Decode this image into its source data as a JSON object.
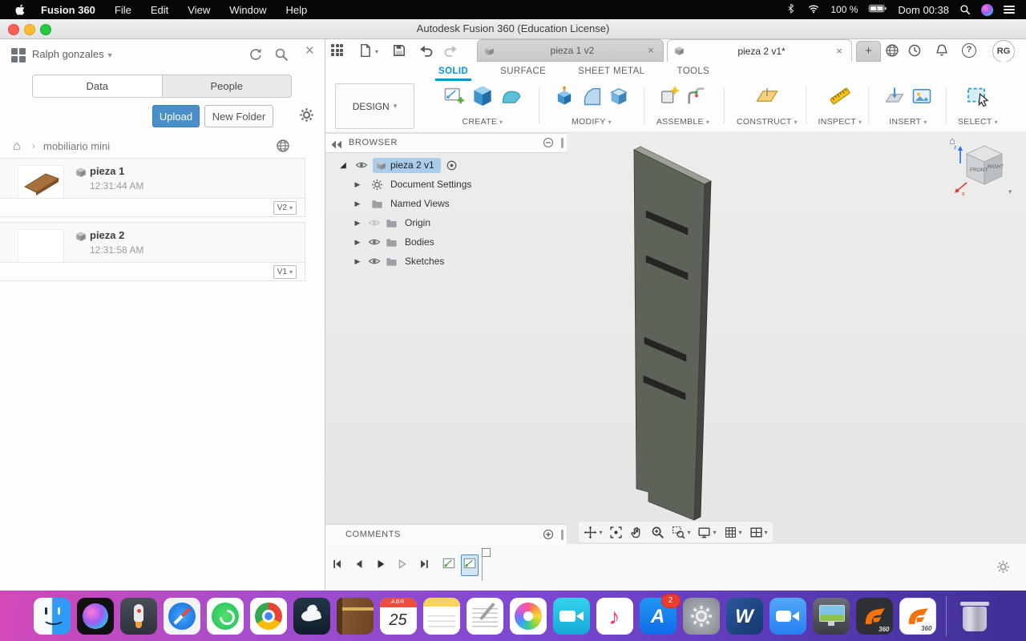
{
  "menubar": {
    "app_name": "Fusion 360",
    "items": [
      "File",
      "Edit",
      "View",
      "Window",
      "Help"
    ],
    "battery_label": "100 %",
    "clock_label": "Dom 00:38"
  },
  "titlebar": {
    "title": "Autodesk Fusion 360 (Education License)"
  },
  "data_panel": {
    "user_name": "Ralph gonzales",
    "tabs": [
      {
        "label": "Data"
      },
      {
        "label": "People"
      }
    ],
    "upload_label": "Upload",
    "new_folder_label": "New Folder",
    "breadcrumb_root": "mobiliario mini",
    "items": [
      {
        "name": "pieza 1",
        "time": "12:31:44 AM",
        "version": "V2"
      },
      {
        "name": "pieza 2",
        "time": "12:31:58 AM",
        "version": "V1"
      }
    ]
  },
  "workspace": {
    "doc_tabs": [
      {
        "label": "pieza 1 v2"
      },
      {
        "label": "pieza 2 v1*"
      }
    ],
    "avatar_initials": "RG",
    "ribbon_tabs": [
      {
        "label": "SOLID"
      },
      {
        "label": "SURFACE"
      },
      {
        "label": "SHEET METAL"
      },
      {
        "label": "TOOLS"
      }
    ],
    "design_menu_label": "DESIGN",
    "groups": [
      {
        "label": "CREATE"
      },
      {
        "label": "MODIFY"
      },
      {
        "label": "ASSEMBLE"
      },
      {
        "label": "CONSTRUCT"
      },
      {
        "label": "INSPECT"
      },
      {
        "label": "INSERT"
      },
      {
        "label": "SELECT"
      }
    ]
  },
  "browser": {
    "title": "BROWSER",
    "root_label": "pieza 2 v1",
    "nodes": [
      {
        "label": "Document Settings"
      },
      {
        "label": "Named Views"
      },
      {
        "label": "Origin"
      },
      {
        "label": "Bodies"
      },
      {
        "label": "Sketches"
      }
    ]
  },
  "comments": {
    "title": "COMMENTS"
  },
  "viewcube": {
    "front_label": "FRONT",
    "right_label": "RIGHT"
  },
  "dock": {
    "calendar_month": "ABR",
    "calendar_day": "25",
    "appstore_badge": "2",
    "fusion_label": "360"
  },
  "colors": {
    "accent_blue": "#0696d7",
    "selection_blue": "#a8cce9",
    "model_gray": "#5e635a",
    "fusion_orange": "#f5730a"
  }
}
